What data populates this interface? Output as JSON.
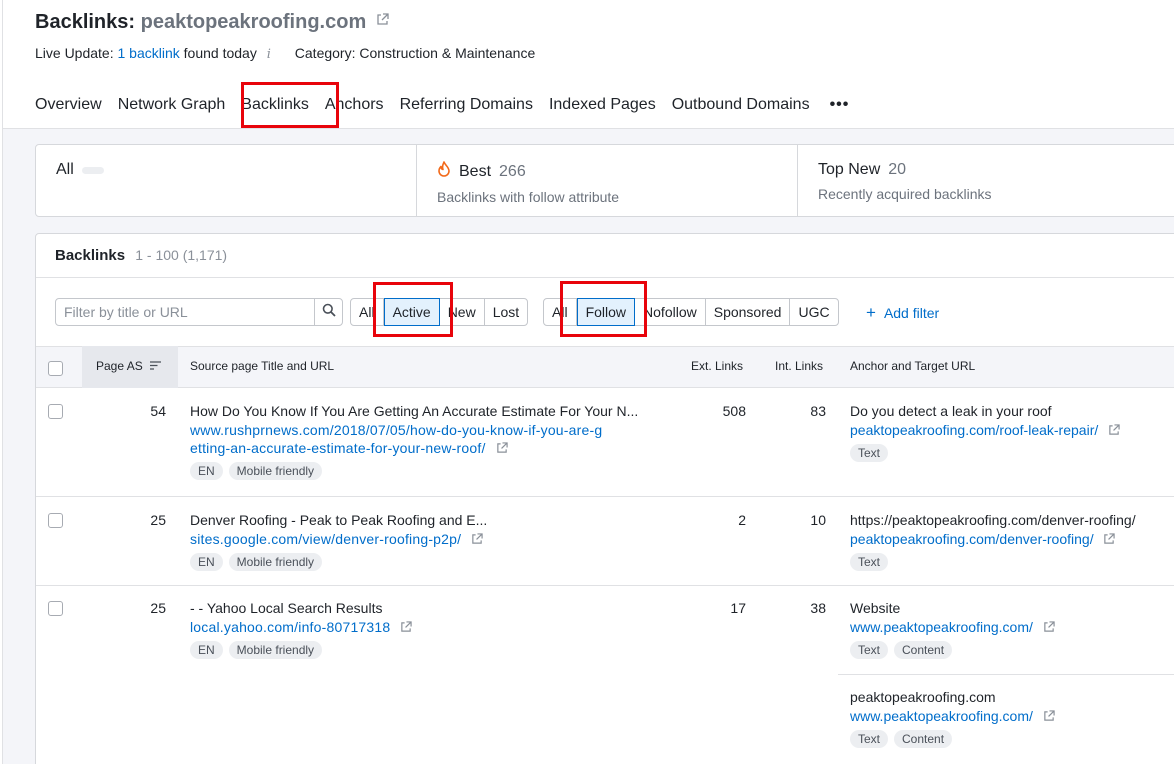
{
  "header": {
    "title_prefix": "Backlinks:",
    "domain": "peaktopeakroofing.com",
    "live_update_label": "Live Update:",
    "live_update_link": "1 backlink",
    "live_update_suffix": "found today",
    "info_glyph": "i",
    "category": "Category: Construction & Maintenance"
  },
  "tabs": [
    "Overview",
    "Network Graph",
    "Backlinks",
    "Anchors",
    "Referring Domains",
    "Indexed Pages",
    "Outbound Domains"
  ],
  "tabs_more": "•••",
  "cards": [
    {
      "name": "All",
      "count": "",
      "desc": ""
    },
    {
      "name": "Best",
      "count": "266",
      "desc": "Backlinks with follow attribute",
      "icon": "flame-icon"
    },
    {
      "name": "Top New",
      "count": "20",
      "desc": "Recently acquired backlinks"
    }
  ],
  "panel": {
    "title": "Backlinks",
    "range": "1 - 100 (1,171)",
    "search_placeholder": "Filter by title or URL",
    "status_filter": [
      "All",
      "Active",
      "New",
      "Lost"
    ],
    "status_selected": "Active",
    "type_filter": [
      "All",
      "Follow",
      "Nofollow",
      "Sponsored",
      "UGC"
    ],
    "type_selected": "Follow",
    "add_filter": "Add filter"
  },
  "table": {
    "headers": {
      "page_as": "Page AS",
      "source": "Source page Title and URL",
      "ext_links": "Ext. Links",
      "int_links": "Int. Links",
      "anchor": "Anchor and Target URL"
    },
    "rows": [
      {
        "page_as": "54",
        "title": "How Do You Know If You Are Getting An Accurate Estimate For Your N...",
        "url_line1": "www.rushprnews.com/2018/07/05/how-do-you-know-if-you-are-g",
        "url_line2": "etting-an-accurate-estimate-for-your-new-roof/",
        "badges": [
          "EN",
          "Mobile friendly"
        ],
        "ext_links": "508",
        "int_links": "83",
        "anchor": "Do you detect a leak in your roof",
        "target": "peaktopeakroofing.com/roof-leak-repair/",
        "anchor_badges": [
          "Text"
        ]
      },
      {
        "page_as": "25",
        "title": "Denver Roofing - Peak to Peak Roofing and E...",
        "url_line1": "sites.google.com/view/denver-roofing-p2p/",
        "badges": [
          "EN",
          "Mobile friendly"
        ],
        "ext_links": "2",
        "int_links": "10",
        "anchor": "https://peaktopeakroofing.com/denver-roofing/",
        "target": "peaktopeakroofing.com/denver-roofing/",
        "anchor_badges": [
          "Text"
        ]
      },
      {
        "page_as": "25",
        "title": "- - Yahoo Local Search Results",
        "url_line1": "local.yahoo.com/info-80717318",
        "badges": [
          "EN",
          "Mobile friendly"
        ],
        "ext_links": "17",
        "int_links": "38",
        "anchor": "Website",
        "target": "www.peaktopeakroofing.com/",
        "anchor_badges": [
          "Text",
          "Content"
        ],
        "anchor2": "peaktopeakroofing.com",
        "target2": "www.peaktopeakroofing.com/",
        "anchor2_badges": [
          "Text",
          "Content"
        ]
      }
    ]
  },
  "colors": {
    "link": "#006dca",
    "highlight_box": "#e8040b",
    "selected_segment": "#e3f1fd"
  }
}
